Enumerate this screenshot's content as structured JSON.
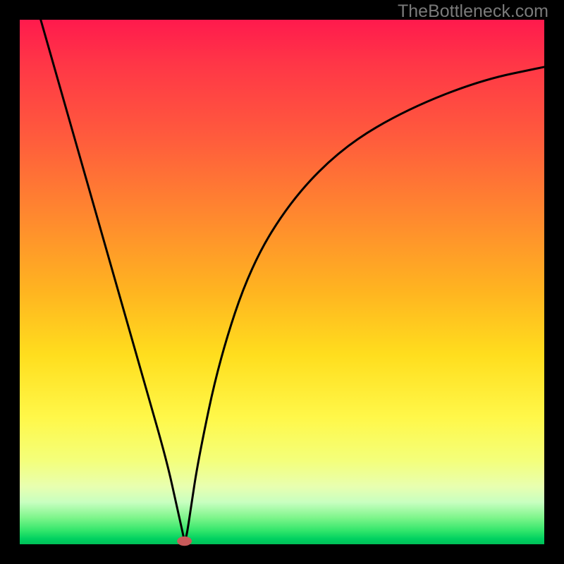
{
  "watermark": "TheBottleneck.com",
  "colors": {
    "gradient_top": "#ff1a4d",
    "gradient_mid": "#ffde1e",
    "gradient_bottom": "#00c058",
    "curve": "#000000",
    "marker": "#c85a5a",
    "frame": "#000000"
  },
  "chart_data": {
    "type": "line",
    "title": "",
    "xlabel": "",
    "ylabel": "",
    "xlim": [
      0,
      100
    ],
    "ylim": [
      0,
      100
    ],
    "series": [
      {
        "name": "bottleneck-curve",
        "x": [
          4,
          8,
          12,
          16,
          20,
          24,
          28,
          30,
          31,
          31.4,
          31.8,
          32.5,
          34,
          38,
          44,
          52,
          62,
          74,
          88,
          100
        ],
        "y": [
          100,
          86,
          72,
          58,
          44,
          30,
          16,
          7,
          2.5,
          0.6,
          1.5,
          6,
          16,
          35,
          53,
          66,
          76,
          83,
          88.5,
          91
        ]
      }
    ],
    "annotations": [
      {
        "name": "optimal-point",
        "x": 31.4,
        "y": 0.6,
        "shape": "ellipse",
        "rx": 1.4,
        "ry": 0.9
      }
    ],
    "legend": false,
    "grid": false
  }
}
